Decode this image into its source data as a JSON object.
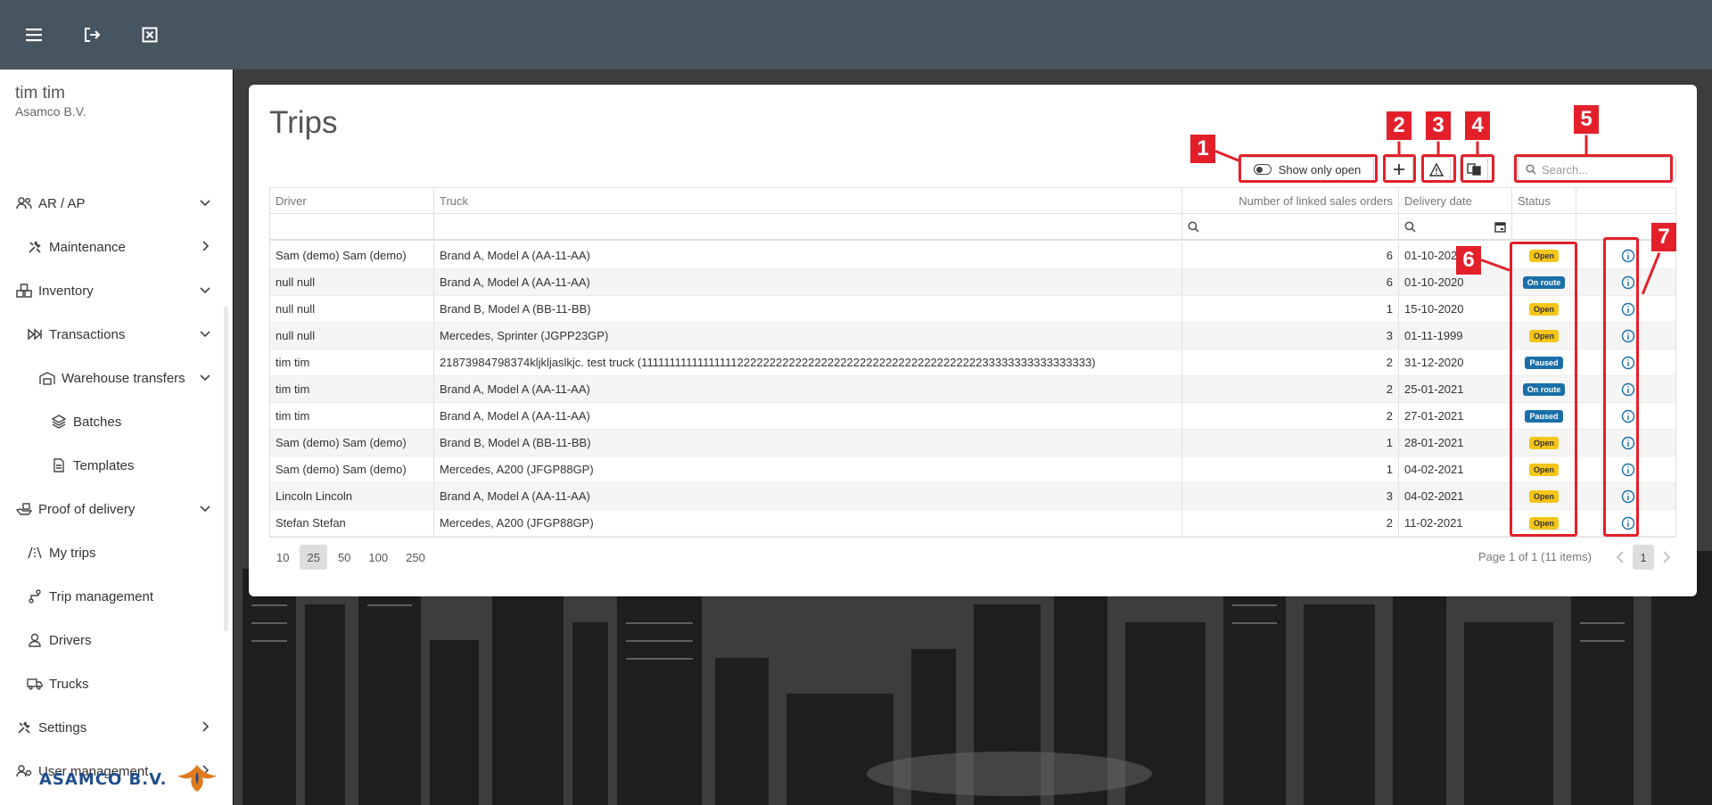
{
  "user": {
    "name": "tim tim",
    "company": "Asamco B.V."
  },
  "sidebar": {
    "items": [
      {
        "label": "AR / AP"
      },
      {
        "label": "Maintenance"
      },
      {
        "label": "Inventory"
      },
      {
        "label": "Transactions"
      },
      {
        "label": "Warehouse transfers"
      },
      {
        "label": "Batches"
      },
      {
        "label": "Templates"
      },
      {
        "label": "Proof of delivery"
      },
      {
        "label": "My trips"
      },
      {
        "label": "Trip management"
      },
      {
        "label": "Drivers"
      },
      {
        "label": "Trucks"
      },
      {
        "label": "Settings"
      },
      {
        "label": "User management"
      }
    ],
    "logo_text": "ASAMCO B.V."
  },
  "page": {
    "title": "Trips",
    "toggle_label": "Show only open",
    "search_placeholder": "Search..."
  },
  "table": {
    "headers": {
      "driver": "Driver",
      "truck": "Truck",
      "linked": "Number of linked sales orders",
      "date": "Delivery date",
      "status": "Status"
    },
    "rows": [
      {
        "driver": "Sam (demo) Sam (demo)",
        "truck": "Brand A, Model A (AA-11-AA)",
        "linked": "6",
        "date": "01-10-2020",
        "status": "Open"
      },
      {
        "driver": "null null",
        "truck": "Brand A, Model A (AA-11-AA)",
        "linked": "6",
        "date": "01-10-2020",
        "status": "On route"
      },
      {
        "driver": "null null",
        "truck": "Brand B, Model A (BB-11-BB)",
        "linked": "1",
        "date": "15-10-2020",
        "status": "Open"
      },
      {
        "driver": "null null",
        "truck": "Mercedes, Sprinter (JGPP23GP)",
        "linked": "3",
        "date": "01-11-1999",
        "status": "Open"
      },
      {
        "driver": "tim tim",
        "truck": "21873984798374kljkljaslkjc. test truck (111111111111111112222222222222222222222222222222222222233333333333333333)",
        "linked": "2",
        "date": "31-12-2020",
        "status": "Paused"
      },
      {
        "driver": "tim tim",
        "truck": "Brand A, Model A (AA-11-AA)",
        "linked": "2",
        "date": "25-01-2021",
        "status": "On route"
      },
      {
        "driver": "tim tim",
        "truck": "Brand A, Model A (AA-11-AA)",
        "linked": "2",
        "date": "27-01-2021",
        "status": "Paused"
      },
      {
        "driver": "Sam (demo) Sam (demo)",
        "truck": "Brand B, Model A (BB-11-BB)",
        "linked": "1",
        "date": "28-01-2021",
        "status": "Open"
      },
      {
        "driver": "Sam (demo) Sam (demo)",
        "truck": "Mercedes, A200 (JFGP88GP)",
        "linked": "1",
        "date": "04-02-2021",
        "status": "Open"
      },
      {
        "driver": "Lincoln Lincoln",
        "truck": "Brand A, Model A (AA-11-AA)",
        "linked": "3",
        "date": "04-02-2021",
        "status": "Open"
      },
      {
        "driver": "Stefan Stefan",
        "truck": "Mercedes, A200 (JFGP88GP)",
        "linked": "2",
        "date": "11-02-2021",
        "status": "Open"
      }
    ]
  },
  "pager": {
    "sizes": [
      "10",
      "25",
      "50",
      "100",
      "250"
    ],
    "active_size": "25",
    "info": "Page 1 of 1 (11 items)",
    "current_page": "1"
  },
  "annotations": [
    "1",
    "2",
    "3",
    "4",
    "5",
    "6",
    "7"
  ],
  "colors": {
    "topbar": "#46555f",
    "accent": "#1a6fa8",
    "open": "#f5c518",
    "annotation": "#e3202a"
  }
}
